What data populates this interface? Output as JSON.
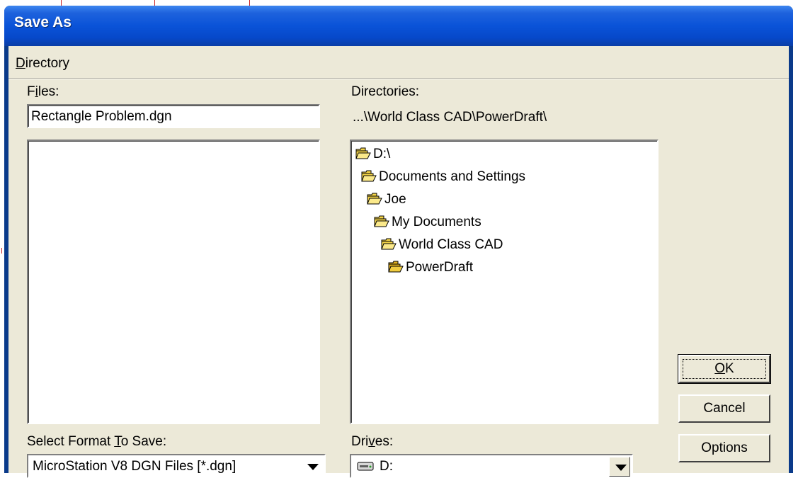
{
  "window": {
    "title": "Save As"
  },
  "menu": {
    "directory": "Directory",
    "directory_accel": "D",
    "directory_rest": "irectory"
  },
  "files": {
    "label_pre": "F",
    "label_accel": "i",
    "label_post": "les:",
    "name_value": "Rectangle Problem.dgn"
  },
  "directories": {
    "label": "Directories:",
    "path": "...\\World Class CAD\\PowerDraft\\",
    "tree": [
      "D:\\",
      "Documents and Settings",
      "Joe",
      "My Documents",
      "World Class CAD",
      "PowerDraft"
    ]
  },
  "format": {
    "label_pre": "Select Format ",
    "label_accel": "T",
    "label_post": "o Save:",
    "selected": "MicroStation V8 DGN Files [*.dgn]"
  },
  "drives": {
    "label_pre": "Dri",
    "label_accel": "v",
    "label_post": "es:",
    "selected": "D:"
  },
  "buttons": {
    "ok_accel": "O",
    "ok_rest": "K",
    "cancel": "Cancel",
    "options": "Options"
  },
  "colors": {
    "titlebar": "#0a53d8",
    "dialog_bg": "#ece9d8",
    "folder": "#f5d547"
  }
}
